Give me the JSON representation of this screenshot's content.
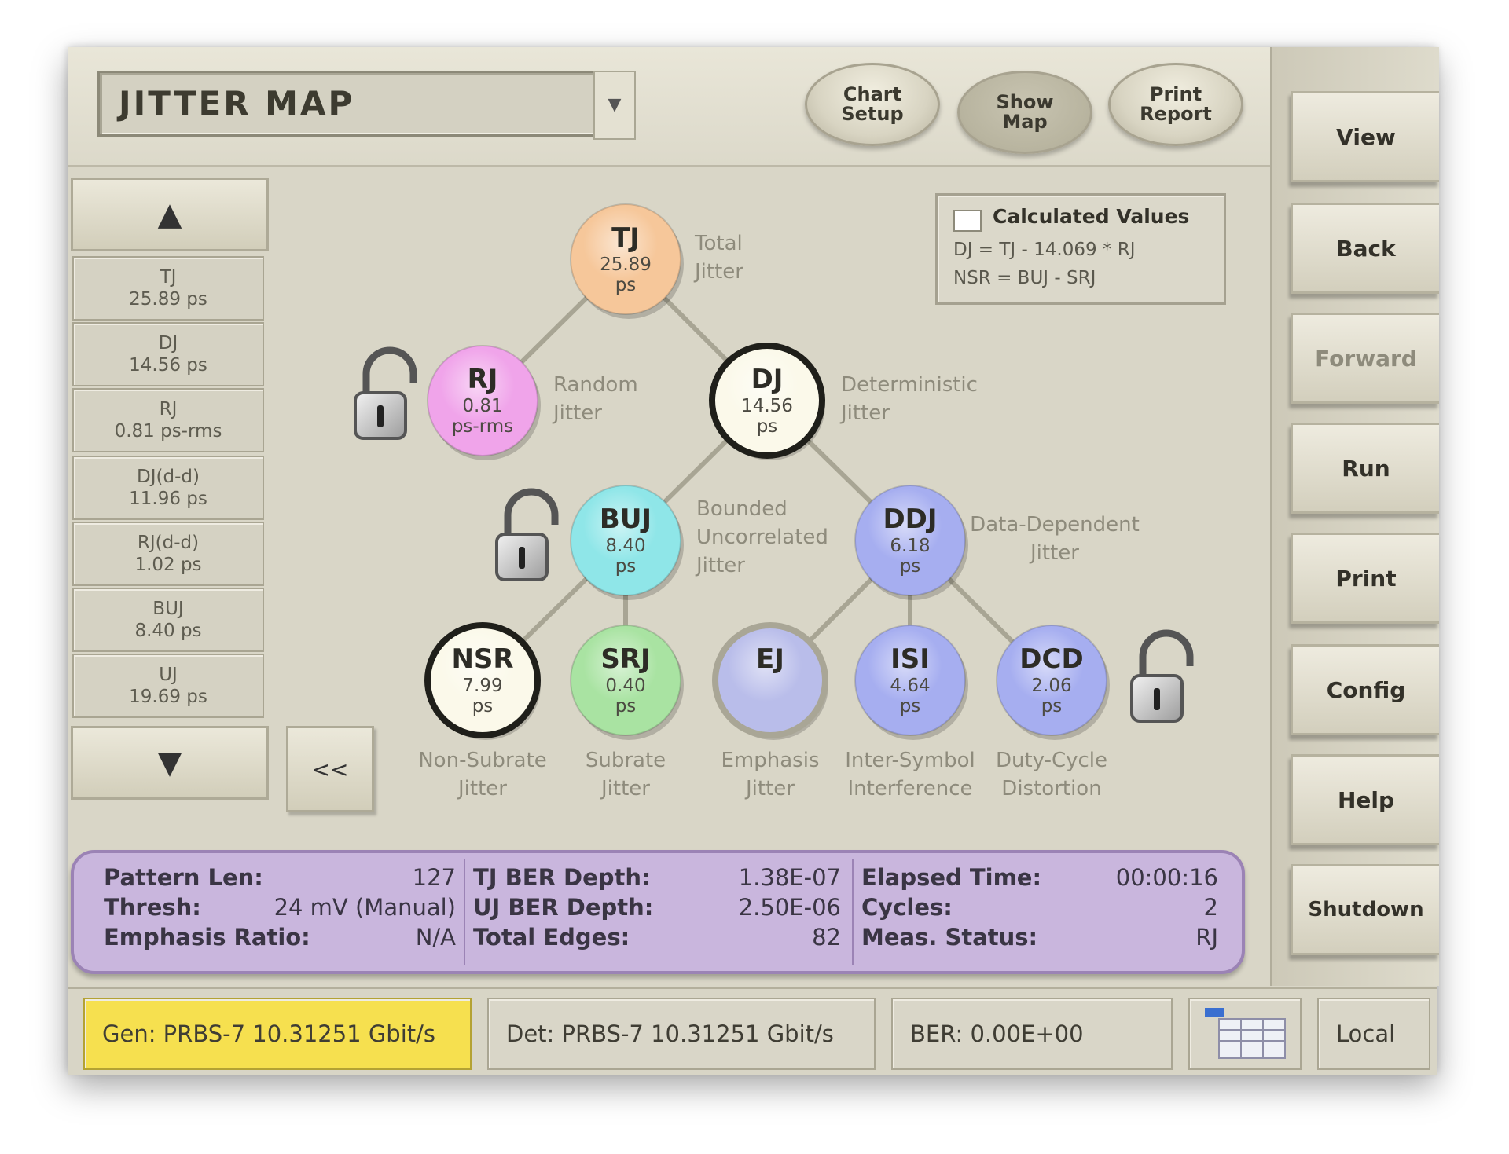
{
  "header": {
    "title": "JITTER MAP",
    "dropdown_icon": "chevron-down-icon"
  },
  "top_buttons": [
    {
      "label": "Chart\nSetup"
    },
    {
      "label": "Show\nMap"
    },
    {
      "label": "Print\nReport"
    }
  ],
  "side_buttons": [
    {
      "label": "View"
    },
    {
      "label": "Back"
    },
    {
      "label": "Forward",
      "disabled": true
    },
    {
      "label": "Run"
    },
    {
      "label": "Print"
    },
    {
      "label": "Config"
    },
    {
      "label": "Help"
    },
    {
      "label": "Shutdown"
    }
  ],
  "list": {
    "up_icon": "triangle-up-icon",
    "down_icon": "triangle-down-icon",
    "items": [
      {
        "name": "TJ",
        "value": "25.89 ps"
      },
      {
        "name": "DJ",
        "value": "14.56 ps"
      },
      {
        "name": "RJ",
        "value": "0.81 ps-rms"
      },
      {
        "name": "DJ(d-d)",
        "value": "11.96 ps"
      },
      {
        "name": "RJ(d-d)",
        "value": "1.02 ps"
      },
      {
        "name": "BUJ",
        "value": "8.40 ps"
      },
      {
        "name": "UJ",
        "value": "19.69 ps"
      }
    ],
    "collapse_label": "<<"
  },
  "calculated": {
    "title": "Calculated Values",
    "lines": [
      "DJ = TJ - 14.069 * RJ",
      "NSR = BUJ - SRJ"
    ]
  },
  "tree": {
    "nodes": [
      {
        "id": "tj",
        "abbr": "TJ",
        "value": "25.89",
        "unit": "ps",
        "label": [
          "Total",
          "Jitter"
        ],
        "color": "#f6c79a"
      },
      {
        "id": "rj",
        "abbr": "RJ",
        "value": "0.81",
        "unit": "ps-rms",
        "label": [
          "Random",
          "Jitter"
        ],
        "color": "#f0a4ea"
      },
      {
        "id": "dj",
        "abbr": "DJ",
        "value": "14.56",
        "unit": "ps",
        "label": [
          "Deterministic",
          "Jitter"
        ],
        "color": "#fbf9ea"
      },
      {
        "id": "buj",
        "abbr": "BUJ",
        "value": "8.40",
        "unit": "ps",
        "label": [
          "Bounded",
          "Uncorrelated",
          "Jitter"
        ],
        "color": "#8fe6e8"
      },
      {
        "id": "ddj",
        "abbr": "DDJ",
        "value": "6.18",
        "unit": "ps",
        "label": [
          "Data-Dependent",
          "Jitter"
        ],
        "color": "#a6aef0"
      },
      {
        "id": "nsr",
        "abbr": "NSR",
        "value": "7.99",
        "unit": "ps",
        "label": [
          "Non-Subrate",
          "Jitter"
        ],
        "color": "#fbf9ea"
      },
      {
        "id": "srj",
        "abbr": "SRJ",
        "value": "0.40",
        "unit": "ps",
        "label": [
          "Subrate",
          "Jitter"
        ],
        "color": "#a9e3a2"
      },
      {
        "id": "ej",
        "abbr": "EJ",
        "value": "",
        "unit": "",
        "label": [
          "Emphasis",
          "Jitter"
        ],
        "color": "#b9bdea"
      },
      {
        "id": "isi",
        "abbr": "ISI",
        "value": "4.64",
        "unit": "ps",
        "label": [
          "Inter-Symbol",
          "Interference"
        ],
        "color": "#a6aef0"
      },
      {
        "id": "dcd",
        "abbr": "DCD",
        "value": "2.06",
        "unit": "ps",
        "label": [
          "Duty-Cycle",
          "Distortion"
        ],
        "color": "#a6aef0"
      }
    ],
    "lock_icon": "padlock-open-icon"
  },
  "stats": {
    "col1": [
      {
        "label": "Pattern Len:",
        "value": "127"
      },
      {
        "label": "Thresh:",
        "value": "24 mV (Manual)"
      },
      {
        "label": "Emphasis Ratio:",
        "value": "N/A"
      }
    ],
    "col2": [
      {
        "label": "TJ BER Depth:",
        "value": "1.38E-07"
      },
      {
        "label": "UJ BER Depth:",
        "value": "2.50E-06"
      },
      {
        "label": "Total Edges:",
        "value": "82"
      }
    ],
    "col3": [
      {
        "label": "Elapsed Time:",
        "value": "00:00:16"
      },
      {
        "label": "Cycles:",
        "value": "2"
      },
      {
        "label": "Meas. Status:",
        "value": "RJ"
      }
    ]
  },
  "status_bar": {
    "gen": "Gen: PRBS-7 10.31251 Gbit/s",
    "det": "Det: PRBS-7 10.31251 Gbit/s",
    "ber": "BER: 0.00E+00",
    "grid_icon": "table-grid-icon",
    "mode": "Local"
  },
  "colors": {
    "accent": "#f6e04f",
    "stats_bg": "#c9b6dd",
    "panel_bg": "#d9d6c7"
  }
}
